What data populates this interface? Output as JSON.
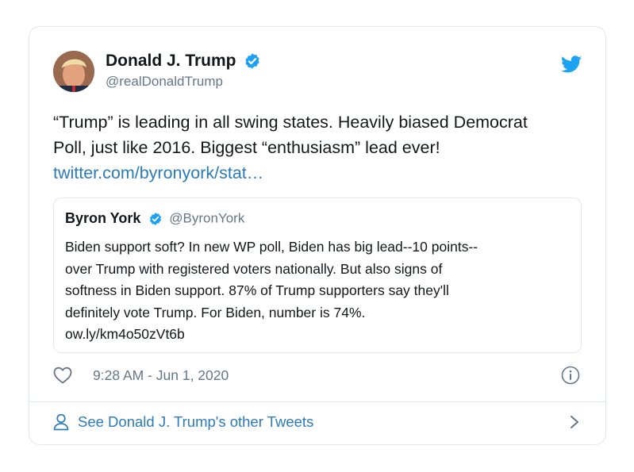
{
  "tweet": {
    "author_name": "Donald J. Trump",
    "author_handle": "@realDonaldTrump",
    "text_lines": [
      "“Trump” is leading in all swing states. Heavily biased Democrat",
      "Poll, just like 2016. Biggest “enthusiasm” lead ever!"
    ],
    "link": "twitter.com/byronyork/stat…",
    "timestamp": "9:28 AM - Jun 1, 2020"
  },
  "quoted_tweet": {
    "author_name": "Byron York",
    "author_handle": "@ByronYork",
    "text_lines": [
      "Biden support soft? In new WP poll, Biden has big lead--10 points--",
      "over Trump with registered voters nationally. But also signs of",
      "softness in Biden support. 87% of Trump supporters say they'll",
      "definitely vote Trump. For Biden, number is 74%.",
      "ow.ly/km4o50zVt6b"
    ]
  },
  "footer": {
    "label": "See Donald J. Trump's other Tweets"
  },
  "icons": {
    "brand": "twitter-bird-icon",
    "verified": "verified-badge-icon",
    "like": "heart-icon",
    "info": "info-icon",
    "profile": "person-icon",
    "chevron": "chevron-right-icon"
  },
  "colors": {
    "brand_blue": "#1da1f2",
    "link_blue": "#2b7bb9",
    "text": "#14171a",
    "muted": "#657786",
    "border": "#e1e8ed"
  }
}
